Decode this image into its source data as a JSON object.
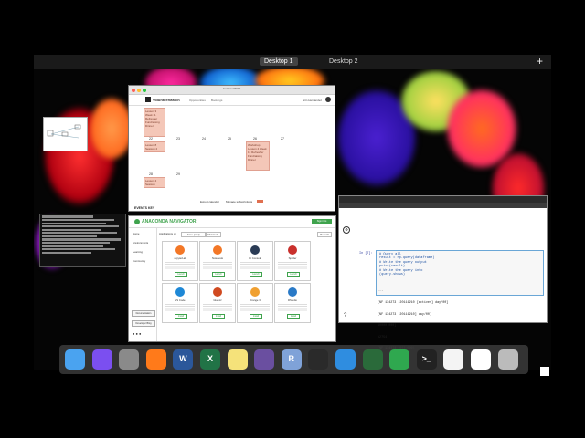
{
  "mission_control": {
    "desktops": [
      "Desktop 1",
      "Desktop 2"
    ],
    "add_label": "+"
  },
  "calendar_window": {
    "title": "localhost:5000",
    "brand": "VolunteerMatch",
    "nav": [
      "Opportunities",
      "Bookings"
    ],
    "user": "Erin Hernandez",
    "days": [
      "22",
      "23",
      "24",
      "25",
      "26",
      "27",
      "28",
      "29"
    ],
    "events": [
      "Lesson 3 Week 11 Refresher Fundraising Dinner",
      "Lesson 8 Session 2",
      "Workshop Lesson 4 Week 13 Refresher Fundraising Dinner",
      "Lesson 4 Session"
    ],
    "footer_export": "Export calendar",
    "footer_manage": "Manage subscriptions",
    "events_key": "EVENTS KEY"
  },
  "anaconda_window": {
    "brand": "ANACONDA NAVIGATOR",
    "sign_in": "Sign in to Anaconda Cloud",
    "sidebar": [
      "Home",
      "Environments",
      "Learning",
      "Community"
    ],
    "sidebar_buttons": [
      "Documentation",
      "Developer Blog"
    ],
    "toolbar": {
      "applications_on": "Applications on",
      "env": "base (root)",
      "channels": "Channels",
      "refresh": "Refresh"
    },
    "apps": [
      {
        "name": "JupyterLab",
        "action": "Launch",
        "color": "#f37726"
      },
      {
        "name": "Notebook",
        "action": "Launch",
        "color": "#f37726"
      },
      {
        "name": "Qt Console",
        "action": "Launch",
        "color": "#2a3b55"
      },
      {
        "name": "Spyder",
        "action": "Launch",
        "color": "#c9302c"
      },
      {
        "name": "VS Code",
        "action": "Install",
        "color": "#1e88d6"
      },
      {
        "name": "Glueviz",
        "action": "Install",
        "color": "#d04a20"
      },
      {
        "name": "Orange 3",
        "action": "Install",
        "color": "#f0a030"
      },
      {
        "name": "RStudio",
        "action": "Install",
        "color": "#2a7ac7"
      }
    ]
  },
  "jupyter_window": {
    "prompt": "In [7]:",
    "code": [
      "# Query all",
      "result = rp.query(dataframe)",
      "# Write the query output",
      "print(result)",
      "# Write the query into",
      "(query.shows)"
    ],
    "output": [
      "...",
      "(NF 134273 (20111210 [actives] day/00]",
      "(NF 134273 [20111210] day/00]",
      "10000 000]",
      "#2754",
      "(NF 134273 [07] 000)"
    ],
    "help": "?"
  },
  "dock": [
    {
      "name": "finder-icon",
      "color": "#4aa3f0"
    },
    {
      "name": "siri-icon",
      "color": "#7b4ff0"
    },
    {
      "name": "launchpad-icon",
      "color": "#8a8a8a"
    },
    {
      "name": "firefox-icon",
      "color": "#ff7a1a"
    },
    {
      "name": "word-icon",
      "color": "#2b579a"
    },
    {
      "name": "excel-icon",
      "color": "#217346"
    },
    {
      "name": "notes-icon",
      "color": "#f5e27a"
    },
    {
      "name": "github-icon",
      "color": "#6a4fa0"
    },
    {
      "name": "r-icon",
      "color": "#7fa2d8"
    },
    {
      "name": "anaconda-icon",
      "color": "#2a2a2a"
    },
    {
      "name": "safari-icon",
      "color": "#2f8de0"
    },
    {
      "name": "navigator-icon",
      "color": "#2a6a3a"
    },
    {
      "name": "sync-icon",
      "color": "#2fa84f"
    },
    {
      "name": "terminal-icon",
      "color": "#222222"
    },
    {
      "name": "document-icon",
      "color": "#f4f4f4"
    },
    {
      "name": "text-document-icon",
      "color": "#ffffff"
    },
    {
      "name": "trash-icon",
      "color": "#bbbbbb"
    }
  ],
  "dock_labels": {
    "word": "W",
    "excel": "X",
    "r": "R",
    "terminal": ">_"
  }
}
